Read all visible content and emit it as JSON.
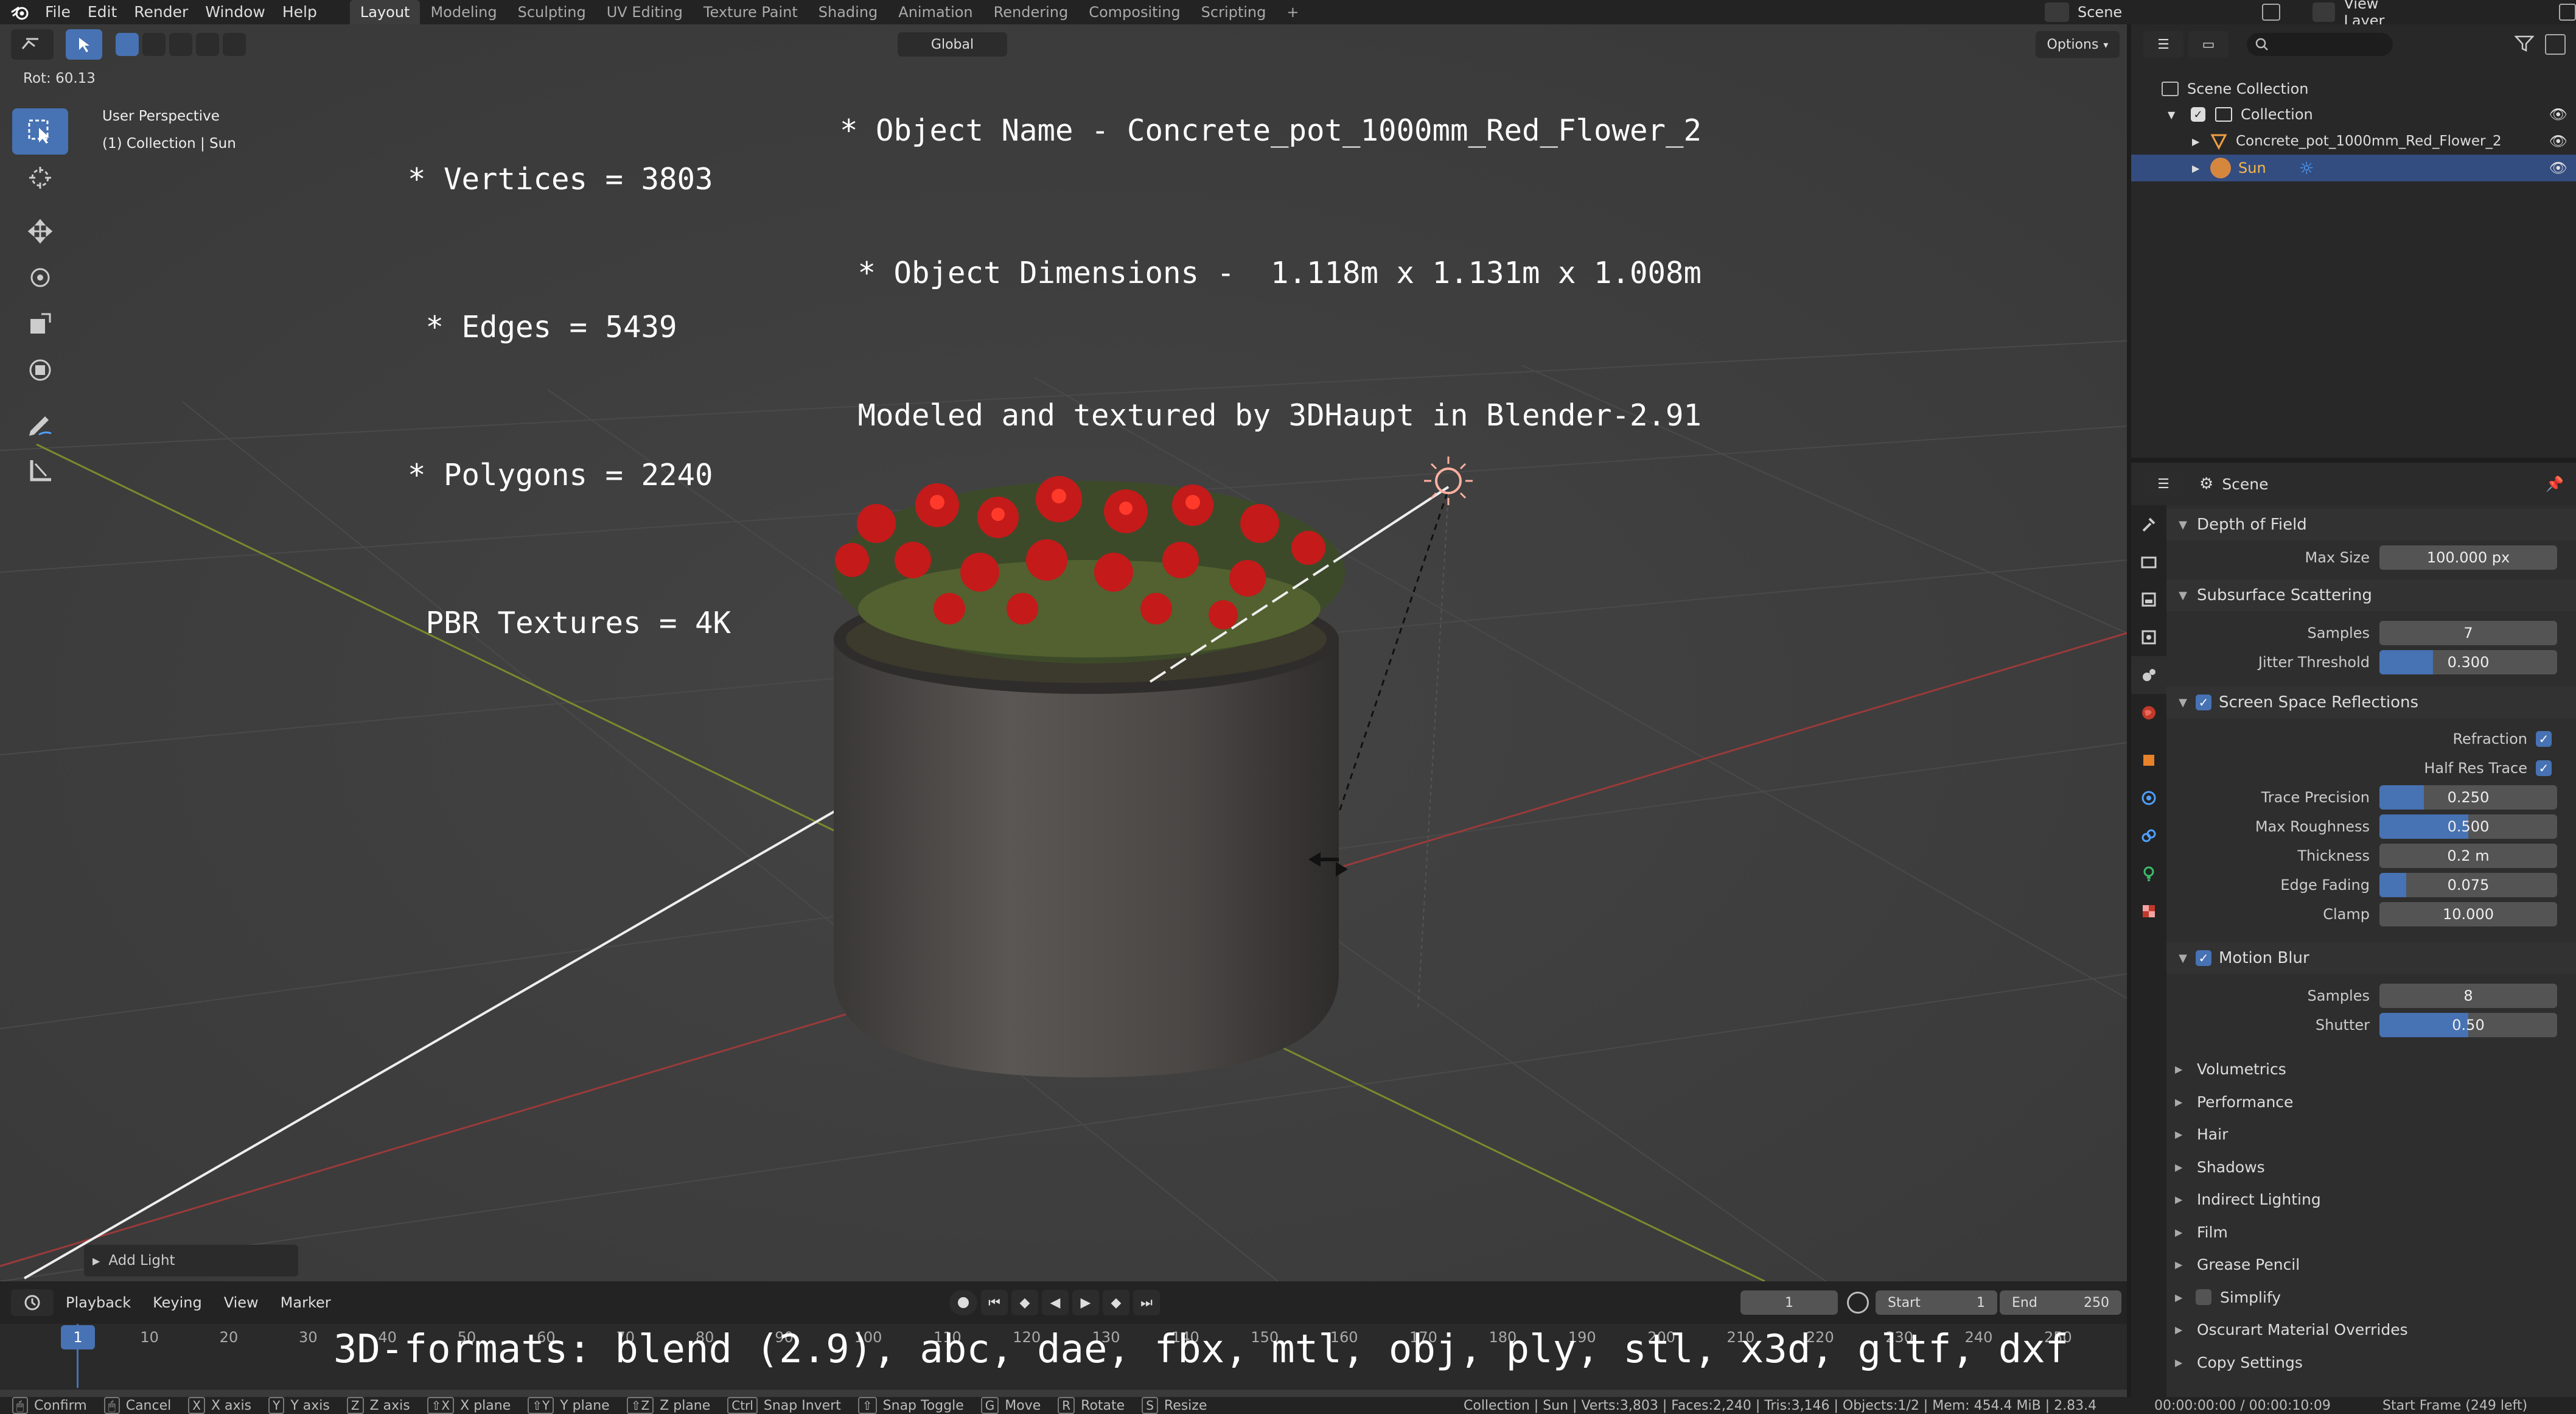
{
  "menu": [
    "File",
    "Edit",
    "Render",
    "Window",
    "Help"
  ],
  "workspaces": [
    "Layout",
    "Modeling",
    "Sculpting",
    "UV Editing",
    "Texture Paint",
    "Shading",
    "Animation",
    "Rendering",
    "Compositing",
    "Scripting",
    "+"
  ],
  "active_workspace": "Layout",
  "scene_name": "Scene",
  "view_layer": "View Layer",
  "viewport": {
    "rot_readout": "Rot: 60.13",
    "perspective": "User Perspective",
    "collection_info": "(1) Collection | Sun",
    "orientation": "Global",
    "options_label": "Options",
    "add_light": "Add Light",
    "overlay_left": [
      "* Vertices = 3803",
      " * Edges = 5439",
      "* Polygons = 2240",
      " PBR Textures = 4K"
    ],
    "overlay_right": [
      "* Object Name - Concrete_pot_1000mm_Red_Flower_2",
      " * Object Dimensions -  1.118m x 1.131m x 1.008m",
      " Modeled and textured by 3DHaupt in Blender-2.91"
    ],
    "overlay_formats": "3D-formats: blend (2.9), abc, dae, fbx, mtl, obj, ply, stl, x3d, gltf, dxf"
  },
  "timeline": {
    "menus": [
      "Playback",
      "Keying",
      "View",
      "Marker"
    ],
    "current_frame": "1",
    "start_label": "Start",
    "start_value": "1",
    "end_label": "End",
    "end_value": "250",
    "ticks": [
      "1",
      "10",
      "20",
      "30",
      "40",
      "50",
      "60",
      "70",
      "80",
      "90",
      "100",
      "110",
      "120",
      "130",
      "140",
      "150",
      "160",
      "170",
      "180",
      "190",
      "200",
      "210",
      "220",
      "230",
      "240",
      "250"
    ]
  },
  "outliner": {
    "scene_collection": "Scene Collection",
    "collection": "Collection",
    "object": "Concrete_pot_1000mm_Red_Flower_2",
    "sun": "Sun"
  },
  "properties": {
    "context": "Scene",
    "dof": {
      "title": "Depth of Field",
      "max_size_label": "Max Size",
      "max_size": "100.000 px"
    },
    "sss": {
      "title": "Subsurface Scattering",
      "samples_label": "Samples",
      "samples": "7",
      "jitter_label": "Jitter Threshold",
      "jitter": "0.300",
      "jitter_fill": 0.3
    },
    "ssr": {
      "title": "Screen Space Reflections",
      "refraction": "Refraction",
      "half_res": "Half Res Trace",
      "trace_label": "Trace Precision",
      "trace": "0.250",
      "trace_fill": 0.25,
      "rough_label": "Max Roughness",
      "rough": "0.500",
      "rough_fill": 0.5,
      "thick_label": "Thickness",
      "thick": "0.2 m",
      "edge_label": "Edge Fading",
      "edge": "0.075",
      "edge_fill": 0.15,
      "clamp_label": "Clamp",
      "clamp": "10.000"
    },
    "mb": {
      "title": "Motion Blur",
      "samples_label": "Samples",
      "samples": "8",
      "shutter_label": "Shutter",
      "shutter": "0.50",
      "shutter_fill": 0.5
    },
    "collapsed": [
      "Volumetrics",
      "Performance",
      "Hair",
      "Shadows",
      "Indirect Lighting",
      "Film",
      "Grease Pencil",
      "Simplify",
      "Oscurart Material Overrides",
      "Copy Settings"
    ]
  },
  "statusbar": {
    "items": [
      {
        "key": "",
        "label": "Confirm"
      },
      {
        "key": "",
        "label": "Cancel"
      },
      {
        "key": "X",
        "label": "X axis"
      },
      {
        "key": "Y",
        "label": "Y axis"
      },
      {
        "key": "Z",
        "label": "Z axis"
      },
      {
        "key": "⇧X",
        "label": "X plane"
      },
      {
        "key": "⇧Y",
        "label": "Y plane"
      },
      {
        "key": "⇧Z",
        "label": "Z plane"
      },
      {
        "key": "Ctrl",
        "label": "Snap Invert"
      },
      {
        "key": "⇧",
        "label": "Snap Toggle"
      },
      {
        "key": "G",
        "label": "Move"
      },
      {
        "key": "R",
        "label": "Rotate"
      },
      {
        "key": "S",
        "label": "Resize"
      }
    ],
    "stats": "Collection | Sun | Verts:3,803 | Faces:2,240 | Tris:3,146 | Objects:1/2 | Mem: 454.4 MiB | 2.83.4",
    "time": "00:00:00:00 / 00:00:10:09",
    "start_frame": "Start Frame (249 left)"
  }
}
